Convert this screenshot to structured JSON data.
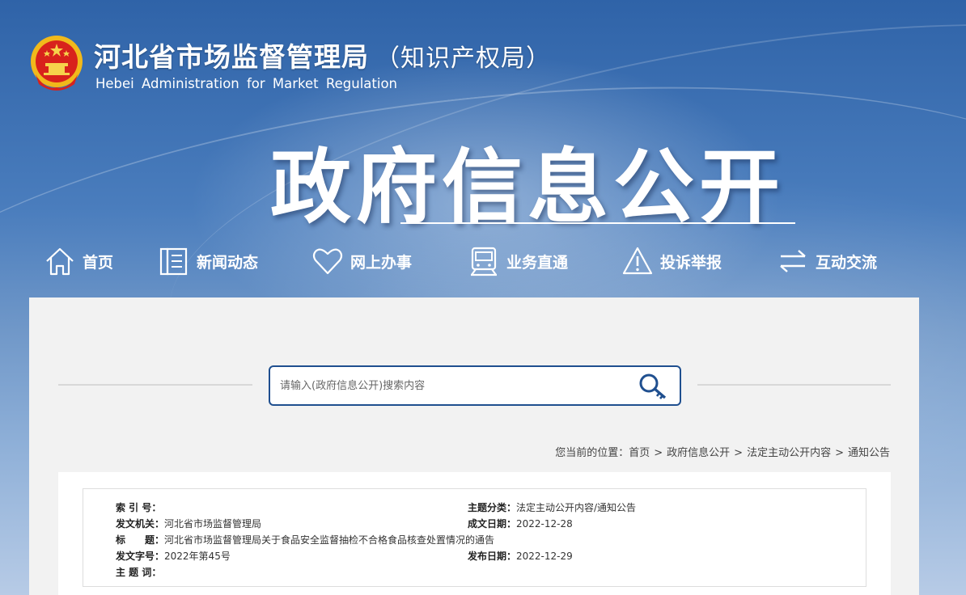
{
  "header": {
    "org_name_cn": "河北省市场监督管理局",
    "org_name_sub": "（知识产权局）",
    "org_name_en": "Hebei Administration for Market Regulation",
    "big_title": "政府信息公开"
  },
  "nav": {
    "items": [
      {
        "label": "首页",
        "icon": "home-icon"
      },
      {
        "label": "新闻动态",
        "icon": "news-icon"
      },
      {
        "label": "网上办事",
        "icon": "heart-icon"
      },
      {
        "label": "业务直通",
        "icon": "train-icon"
      },
      {
        "label": "投诉举报",
        "icon": "warning-icon"
      },
      {
        "label": "互动交流",
        "icon": "exchange-icon"
      }
    ]
  },
  "search": {
    "placeholder": "请输入(政府信息公开)搜索内容",
    "icon": "search-key-icon"
  },
  "breadcrumb": {
    "prefix": "您当前的位置：",
    "items": [
      "首页",
      "政府信息公开",
      "法定主动公开内容",
      "通知公告"
    ],
    "separator": ">"
  },
  "info": {
    "index_label": "索 引 号：",
    "index_value": "",
    "issuer_label": "发文机关：",
    "issuer_value": "河北省市场监督管理局",
    "title_label": "标　　题：",
    "title_value": "河北省市场监督管理局关于食品安全监督抽检不合格食品核查处置情况的通告",
    "docno_label": "发文字号：",
    "docno_value": "2022年第45号",
    "keywords_label": "主 题 词：",
    "keywords_value": "",
    "category_label": "主题分类：",
    "category_value": "法定主动公开内容/通知公告",
    "created_label": "成文日期：",
    "created_value": "2022-12-28",
    "published_label": "发布日期：",
    "published_value": "2022-12-29"
  }
}
